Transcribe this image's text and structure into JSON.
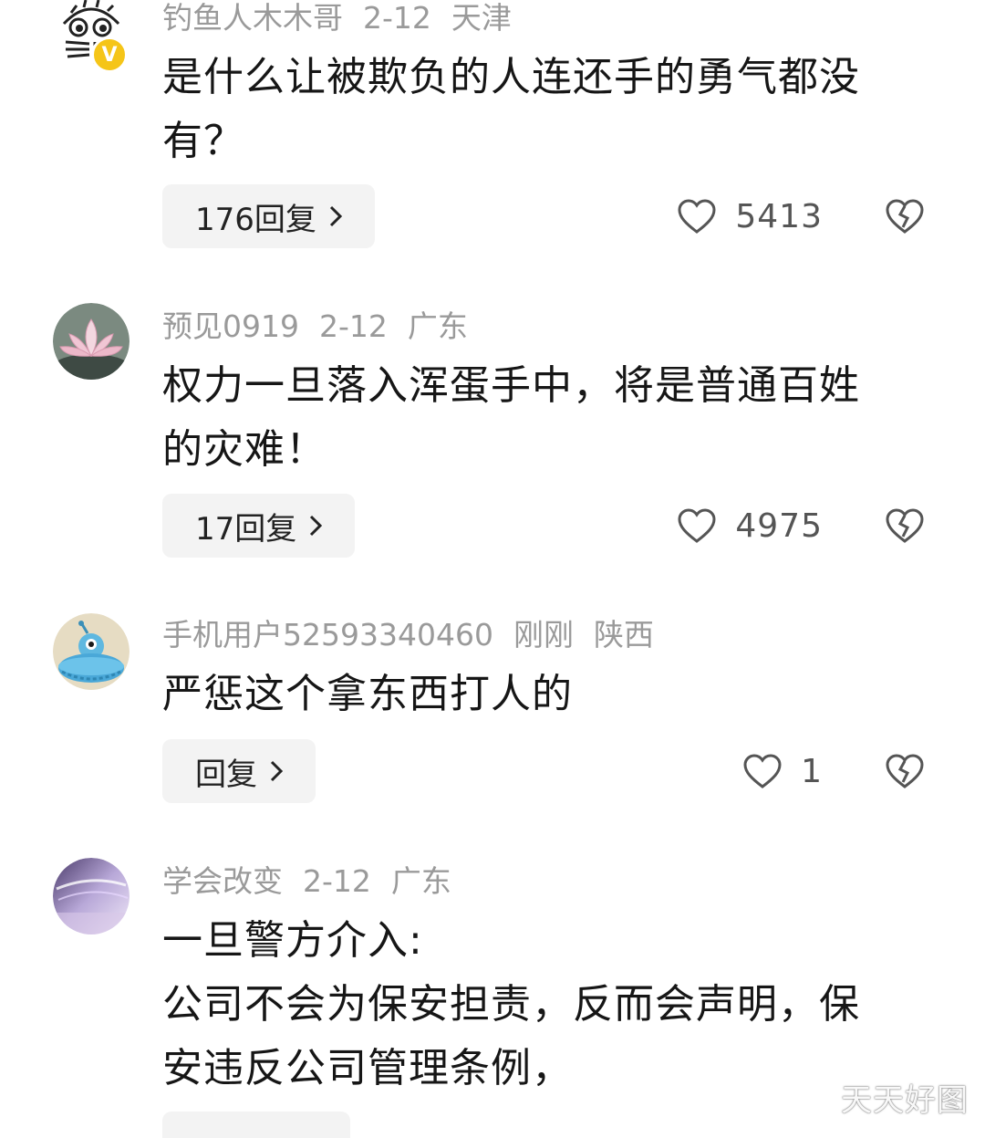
{
  "comments": [
    {
      "username": "钓鱼人木木哥",
      "date": "2-12",
      "location": "天津",
      "content_lines": [
        "是什么让被欺负的人连还手的勇气都没",
        "有？"
      ],
      "reply_label": "176回复",
      "likes": "5413",
      "avatar_icon": "cartoon-face-avatar-icon",
      "verified_badge": "V"
    },
    {
      "username": "预见0919",
      "date": "2-12",
      "location": "广东",
      "content_lines": [
        "权力一旦落入浑蛋手中，将是普通百姓",
        "的灾难！"
      ],
      "reply_label": "17回复",
      "likes": "4975",
      "avatar_icon": "lotus-flower-avatar-icon"
    },
    {
      "username": "手机用户52593340460",
      "date": "刚刚",
      "location": "陕西",
      "content_lines": [
        "严惩这个拿东西打人的"
      ],
      "reply_label": "回复",
      "likes": "1",
      "avatar_icon": "alien-ufo-avatar-icon"
    },
    {
      "username": "学会改变",
      "date": "2-12",
      "location": "广东",
      "content_lines": [
        "一旦警方介入:",
        "公司不会为保安担责，反而会声明，保",
        "安违反公司管理条例，"
      ],
      "avatar_icon": "purple-abstract-avatar-icon"
    }
  ],
  "watermark": "天天好图",
  "colors": {
    "meta_text": "#9a9a9a",
    "content_text": "#161616",
    "reply_button_bg": "#f3f3f3",
    "badge": "#f5c518"
  }
}
